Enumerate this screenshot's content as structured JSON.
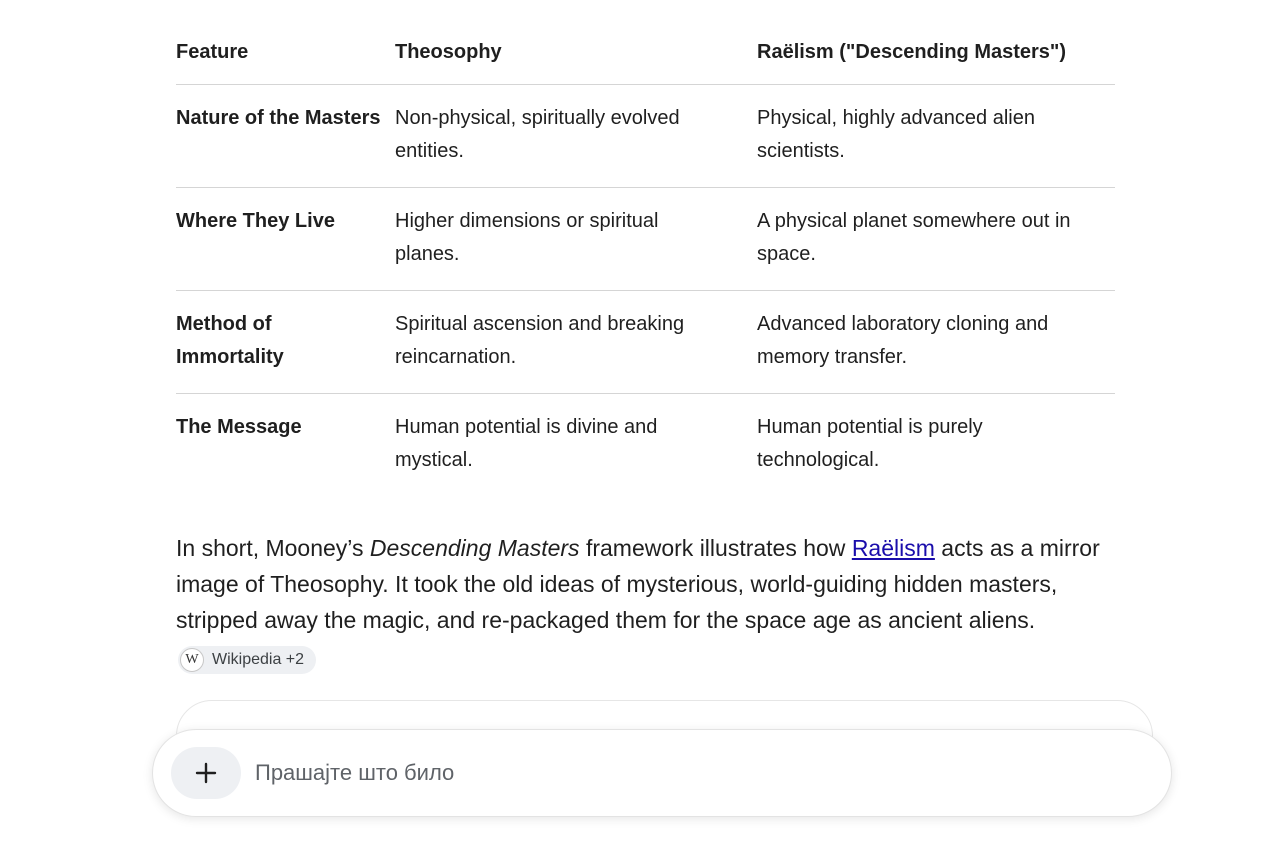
{
  "table": {
    "headers": [
      "Feature",
      "Theosophy",
      "Raëlism (\"Descending Masters\")"
    ],
    "rows": [
      [
        "Nature of the Masters",
        "Non-physical, spiritually evolved entities.",
        "Physical, highly advanced alien scientists."
      ],
      [
        "Where They Live",
        "Higher dimensions or spiritual planes.",
        "A physical planet somewhere out in space."
      ],
      [
        "Method of Immortality",
        "Spiritual ascension and breaking reincarnation.",
        "Advanced laboratory cloning and memory transfer."
      ],
      [
        "The Message",
        "Human potential is divine and mystical.",
        "Human potential is purely technological."
      ]
    ]
  },
  "summary": {
    "part1": "In short, Mooney’s ",
    "italic": "Descending Masters",
    "part2": " framework illustrates how ",
    "link": "Raëlism",
    "part3": " acts as a mirror image of Theosophy. It took the old ideas of mysterious, world-guiding hidden masters, stripped away the magic, and re-packaged them for the space age as ancient aliens.",
    "citation": {
      "icon": "W",
      "label": "Wikipedia +2"
    }
  },
  "composer": {
    "placeholder": "Прашајте што било",
    "add_icon": "plus-icon"
  }
}
